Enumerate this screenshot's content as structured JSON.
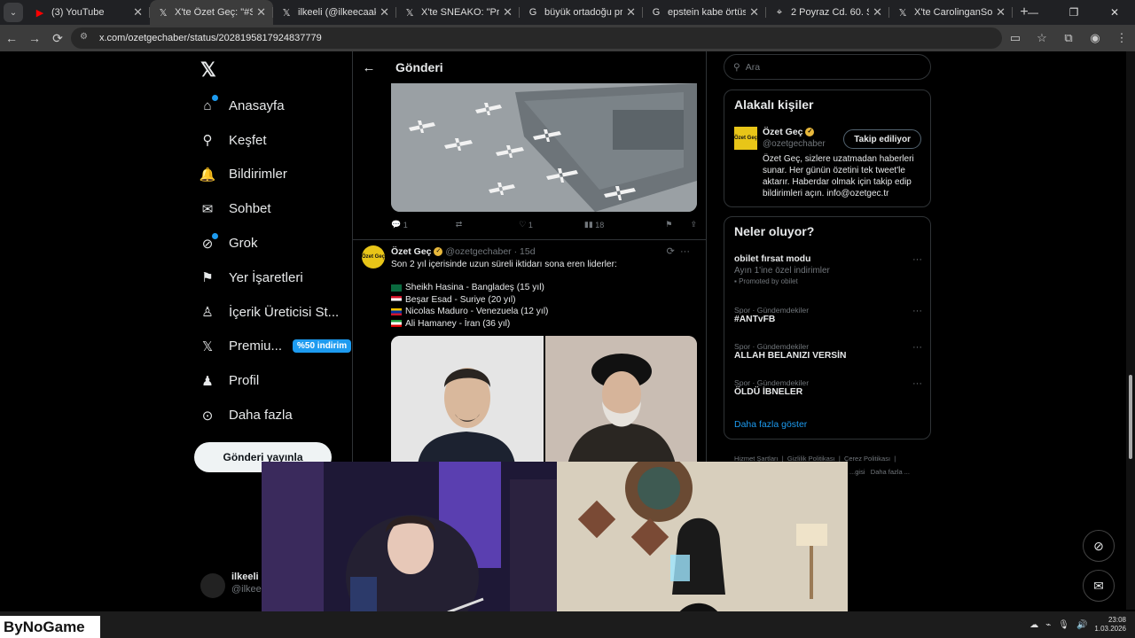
{
  "browser": {
    "tabs": [
      {
        "title": "(3) YouTube",
        "icon": "youtube-icon",
        "active": false
      },
      {
        "title": "X'te Özet Geç: \"#SONDAK",
        "icon": "x-icon",
        "active": true
      },
      {
        "title": "ilkeeli (@ilkeecaakir) / X",
        "icon": "x-icon",
        "active": false
      },
      {
        "title": "X'te SNEAKO: \"Protect Tu",
        "icon": "x-icon",
        "active": false
      },
      {
        "title": "büyük ortadoğu projesi h",
        "icon": "google-icon",
        "active": false
      },
      {
        "title": "epstein kabe örtüsünü kim",
        "icon": "google-icon",
        "active": false
      },
      {
        "title": "2 Poyraz Cd. 60. Sk. - Goo",
        "icon": "maps-icon",
        "active": false
      },
      {
        "title": "X'te CarolinganSon: \"@E",
        "icon": "x-icon",
        "active": false
      }
    ],
    "url": "x.com/ozetgechaber/status/2028195817924837779"
  },
  "sidebar": {
    "items": [
      {
        "label": "Anasayfa",
        "icon": "home-icon"
      },
      {
        "label": "Keşfet",
        "icon": "search-icon"
      },
      {
        "label": "Bildirimler",
        "icon": "bell-icon"
      },
      {
        "label": "Sohbet",
        "icon": "mail-icon"
      },
      {
        "label": "Grok",
        "icon": "grok-icon"
      },
      {
        "label": "Yer İşaretleri",
        "icon": "bookmark-icon"
      },
      {
        "label": "İçerik Üreticisi St...",
        "icon": "creator-icon"
      },
      {
        "label": "Premiu...",
        "icon": "x-premium-icon"
      },
      {
        "label": "Profil",
        "icon": "person-icon"
      },
      {
        "label": "Daha fazla",
        "icon": "more-circle-icon"
      }
    ],
    "premium_badge": "%50 indirim",
    "post_button": "Gönderi yayınla",
    "account": {
      "name": "ilkeeli",
      "handle": "@ilkee"
    }
  },
  "main": {
    "header_title": "Gönderi",
    "prev_post_actions": {
      "replies": "1",
      "likes": "1",
      "views": "18"
    },
    "tweet": {
      "name": "Özet Geç",
      "handle": "@ozetgechaber",
      "time": "15d",
      "avatar_text": "Özet Geç",
      "intro": "Son 2 yıl içerisinde uzun süreli iktidarı sona eren liderler:",
      "lines": [
        {
          "text": "Sheikh Hasina - Bangladeş (15 yıl)",
          "flag": "bangladesh-flag"
        },
        {
          "text": "Beşar Esad - Suriye (20 yıl)",
          "flag": "syria-flag"
        },
        {
          "text": "Nicolas Maduro - Venezuela (12 yıl)",
          "flag": "venezuela-flag"
        },
        {
          "text": "Ali Hamaney - İran (36 yıl)",
          "flag": "iran-flag"
        }
      ]
    }
  },
  "right": {
    "search_placeholder": "Ara",
    "people": {
      "title": "Alakalı kişiler",
      "name": "Özet Geç",
      "handle": "@ozetgechaber",
      "follow_label": "Takip ediliyor",
      "bio": "Özet Geç, sizlere uzatmadan haberleri sunar. Her günün özetini tek tweet'le aktarır. Haberdar olmak için takip edip bildirimleri açın. info@ozetgec.tr"
    },
    "trends": {
      "title": "Neler oluyor?",
      "items": [
        {
          "context": "",
          "name": "obilet fırsat modu",
          "sub": "Ayın 1'ine özel indirimler",
          "promoted": "Promoted by obilet"
        },
        {
          "context": "Spor · Gündemdekiler",
          "name": "#ANTvFB"
        },
        {
          "context": "Spor · Gündemdekiler",
          "name": "ALLAH BELANIZI VERSİN"
        },
        {
          "context": "Spor · Gündemdekiler",
          "name": "ÖLDÜ İBNELER"
        }
      ],
      "show_more": "Daha fazla göster"
    },
    "footer": [
      "Hizmet Şartları",
      "Gizlilik Politikası",
      "Çerez Politikası",
      "...gisi",
      "Daha fazla ..."
    ]
  },
  "overlay": {
    "brand": "ByNoGame"
  },
  "taskbar": {
    "time": "23:08",
    "date": "1.03.2026"
  },
  "colors": {
    "accent": "#1d9bf0",
    "verified": "#e8b83c",
    "avatar": "#e8c518"
  }
}
